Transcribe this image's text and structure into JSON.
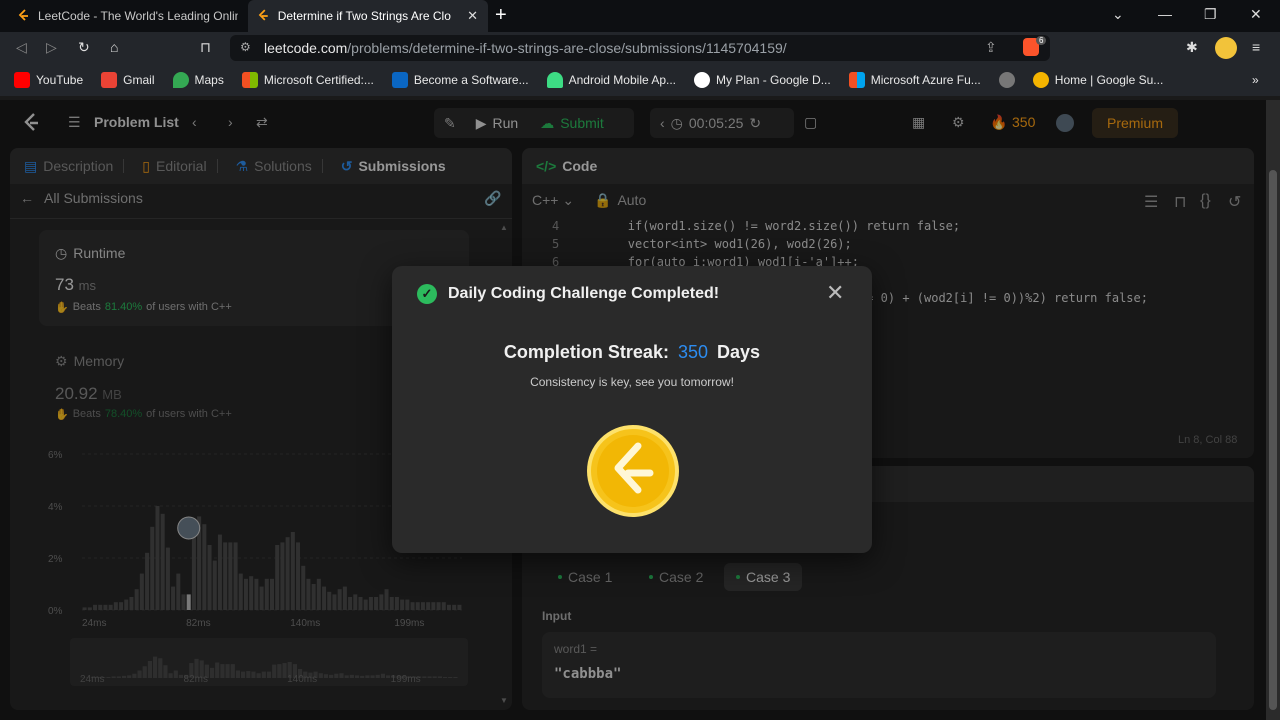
{
  "browser": {
    "tabs": [
      {
        "title": "LeetCode - The World's Leading Onlin"
      },
      {
        "title": "Determine if Two Strings Are Clo"
      }
    ],
    "url_host": "leetcode.com",
    "url_path": "/problems/determine-if-two-strings-are-close/submissions/1145704159/",
    "bookmarks": [
      "YouTube",
      "Gmail",
      "Maps",
      "Microsoft Certified:...",
      "Become a Software...",
      "Android Mobile Ap...",
      "My Plan - Google D...",
      "Microsoft Azure Fu...",
      "Home | Google Su..."
    ],
    "brave_badge": "6"
  },
  "nav": {
    "problem_list": "Problem List",
    "run": "Run",
    "submit": "Submit",
    "timer": "00:05:25",
    "streak_count": "350",
    "premium": "Premium"
  },
  "left": {
    "tabs": [
      "Description",
      "Editorial",
      "Solutions",
      "Submissions"
    ],
    "back_label": "All Submissions",
    "runtime": {
      "label": "Runtime",
      "value": "73",
      "unit": "ms",
      "beats_prefix": "Beats",
      "beats_pct": "81.40%",
      "beats_suffix": "of users with C++"
    },
    "memory": {
      "label": "Memory",
      "value": "20.92",
      "unit": "MB",
      "beats_prefix": "Beats",
      "beats_pct": "78.40%",
      "beats_suffix": "of users with C++"
    },
    "chart_y_ticks": [
      "6%",
      "4%",
      "2%",
      "0%"
    ],
    "chart_x_ticks": [
      "24ms",
      "82ms",
      "140ms",
      "199ms"
    ]
  },
  "chart_data": {
    "type": "bar",
    "xlabel": "",
    "ylabel": "",
    "ylim": [
      0,
      6
    ],
    "x_ticks": [
      "24ms",
      "82ms",
      "140ms",
      "199ms"
    ],
    "values": [
      0.1,
      0.1,
      0.2,
      0.2,
      0.2,
      0.2,
      0.3,
      0.3,
      0.4,
      0.5,
      0.8,
      1.4,
      2.2,
      3.2,
      4.0,
      3.7,
      2.4,
      0.9,
      1.4,
      0.6,
      0.6,
      2.8,
      3.6,
      3.3,
      2.5,
      1.9,
      2.9,
      2.6,
      2.6,
      2.6,
      1.4,
      1.2,
      1.3,
      1.2,
      0.9,
      1.2,
      1.2,
      2.5,
      2.6,
      2.8,
      3.0,
      2.6,
      1.7,
      1.2,
      1.0,
      1.2,
      0.9,
      0.7,
      0.6,
      0.8,
      0.9,
      0.5,
      0.6,
      0.5,
      0.4,
      0.5,
      0.5,
      0.6,
      0.8,
      0.5,
      0.5,
      0.4,
      0.4,
      0.3,
      0.3,
      0.3,
      0.3,
      0.3,
      0.3,
      0.3,
      0.2,
      0.2,
      0.2
    ],
    "highlight_index": 20
  },
  "editor": {
    "title": "Code",
    "language": "C++",
    "mode": "Auto",
    "lines": [
      {
        "n": "4",
        "text": "        if(word1.size() != word2.size()) return false;"
      },
      {
        "n": "5",
        "text": "        vector<int> wod1(26), wod2(26);"
      },
      {
        "n": "6",
        "text": "        for(auto i:word1) wod1[i-'a']++;"
      },
      {
        "n": "",
        "text": "                                  d1[i] != 0) + (wod2[i] != 0))%2) return false;"
      }
    ],
    "cursor": "Ln 8, Col 88"
  },
  "testcase": {
    "cases": [
      "Case 1",
      "Case 2",
      "Case 3"
    ],
    "input_label": "Input",
    "var_label": "word1 =",
    "var_value": "\"cabbba\""
  },
  "modal": {
    "title": "Daily Coding Challenge Completed!",
    "streak_label": "Completion Streak:",
    "streak_value": "350",
    "streak_unit": "Days",
    "subtitle": "Consistency is key, see you tomorrow!"
  },
  "colors": {
    "accent_green": "#2cbb5d",
    "accent_blue": "#2d8cf0",
    "premium": "#ffa116"
  }
}
